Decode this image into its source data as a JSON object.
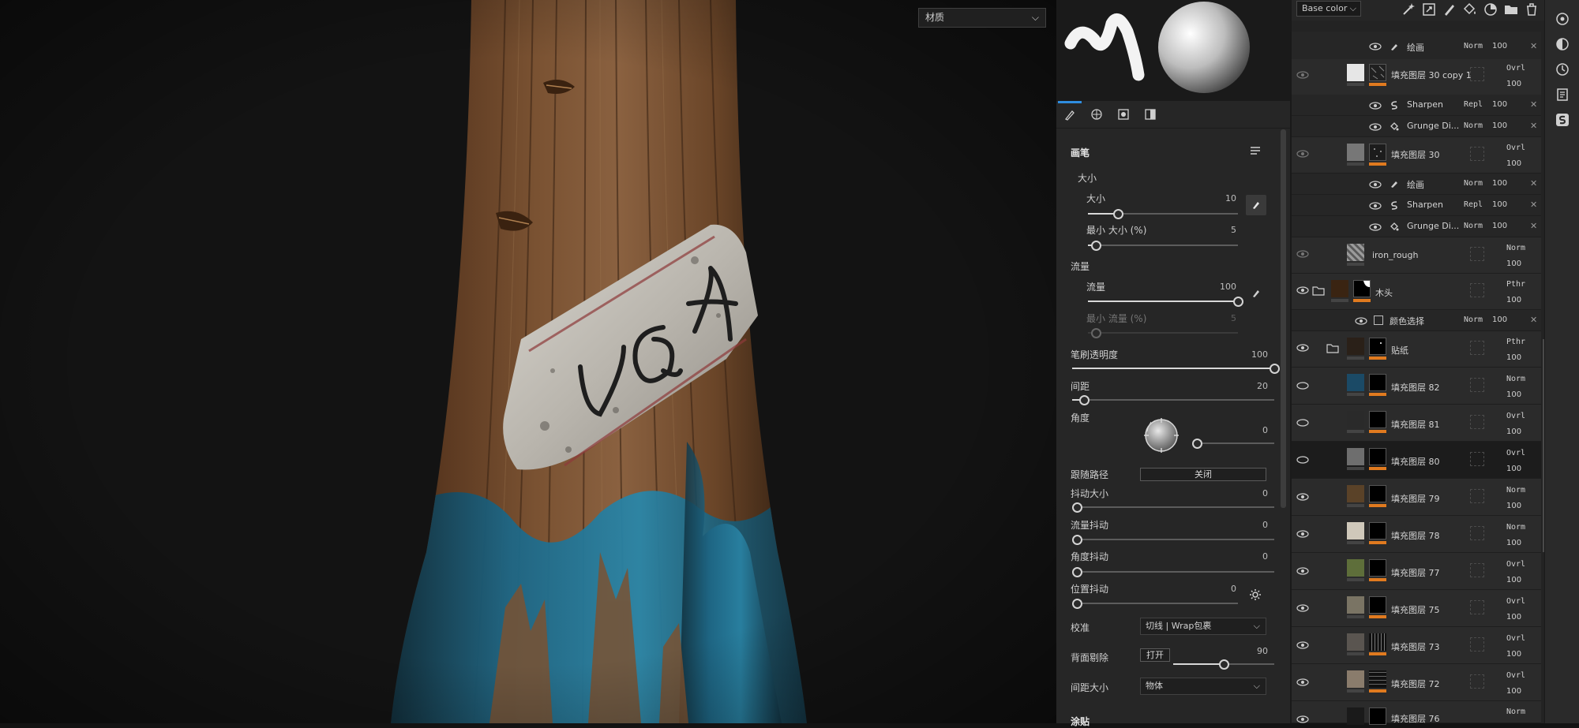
{
  "viewport": {
    "material_select": "材质"
  },
  "brush": {
    "section_title": "画笔",
    "size_group": "大小",
    "size_label": "大小",
    "size_value": "10",
    "size_fraction": 0.2,
    "min_size_label": "最小 大小 (%)",
    "min_size_value": "5",
    "min_size_fraction": 0.05,
    "flow_group": "流量",
    "flow_label": "流量",
    "flow_value": "100",
    "flow_fraction": 1.0,
    "min_flow_label": "最小 流量 (%)",
    "min_flow_value": "5",
    "min_flow_fraction": 0.05,
    "opacity_label": "笔刷透明度",
    "opacity_value": "100",
    "opacity_fraction": 1.0,
    "spacing_label": "间距",
    "spacing_value": "20",
    "spacing_fraction": 0.06,
    "angle_label": "角度",
    "angle_value": "0",
    "angle_fraction": 0.0,
    "follow_path_label": "跟随路径",
    "follow_path_button": "关闭",
    "size_jitter_label": "抖动大小",
    "size_jitter_value": "0",
    "flow_jitter_label": "流量抖动",
    "flow_jitter_value": "0",
    "angle_jitter_label": "角度抖动",
    "angle_jitter_value": "0",
    "position_jitter_label": "位置抖动",
    "position_jitter_value": "0",
    "alignment_label": "校准",
    "alignment_value": "切线 | Wrap包裹",
    "backface_label": "背面剔除",
    "backface_button": "打开",
    "backface_value": "90",
    "backface_fraction": 0.5,
    "spacing_size_label": "间距大小",
    "spacing_size_value": "物体",
    "stencil_label": "涂贴"
  },
  "layers": {
    "channel": "Base color",
    "items": [
      {
        "name": "绘画",
        "blend": "Norm",
        "opacity": "100"
      },
      {
        "name": "填充图层 30 copy 1",
        "blend": "Ovrl",
        "opacity": "100"
      },
      {
        "name": "Sharpen",
        "blend": "Repl",
        "opacity": "100"
      },
      {
        "name": "Grunge Di...",
        "blend": "Norm",
        "opacity": "100"
      },
      {
        "name": "填充图层 30",
        "blend": "Ovrl",
        "opacity": "100"
      },
      {
        "name": "绘画",
        "blend": "Norm",
        "opacity": "100"
      },
      {
        "name": "Sharpen",
        "blend": "Repl",
        "opacity": "100"
      },
      {
        "name": "Grunge Di...",
        "blend": "Norm",
        "opacity": "100"
      },
      {
        "name": "iron_rough",
        "blend": "Norm",
        "opacity": "100"
      },
      {
        "name": "木头",
        "blend": "Pthr",
        "opacity": "100"
      },
      {
        "name": "颜色选择",
        "blend": "Norm",
        "opacity": "100"
      },
      {
        "name": "贴纸",
        "blend": "Pthr",
        "opacity": "100"
      },
      {
        "name": "填充图层 82",
        "blend": "Norm",
        "opacity": "100"
      },
      {
        "name": "填充图层 81",
        "blend": "Ovrl",
        "opacity": "100"
      },
      {
        "name": "填充图层 80",
        "blend": "Ovrl",
        "opacity": "100"
      },
      {
        "name": "填充图层 79",
        "blend": "Norm",
        "opacity": "100"
      },
      {
        "name": "填充图层 78",
        "blend": "Norm",
        "opacity": "100"
      },
      {
        "name": "填充图层 77",
        "blend": "Ovrl",
        "opacity": "100"
      },
      {
        "name": "填充图层 75",
        "blend": "Ovrl",
        "opacity": "100"
      },
      {
        "name": "填充图层 73",
        "blend": "Ovrl",
        "opacity": "100"
      },
      {
        "name": "填充图层 72",
        "blend": "Ovrl",
        "opacity": "100"
      },
      {
        "name": "填充图层 76",
        "blend": "Norm",
        "opacity": ""
      }
    ],
    "colors": {
      "accent_orange": "#e07a1f",
      "selection_blue": "#2f8de0"
    }
  },
  "icons": {
    "toolbar": [
      "magic-wand-icon",
      "add-effect-icon",
      "paint-brush-icon",
      "fill-bucket-icon",
      "smart-material-icon",
      "folder-icon",
      "trash-icon"
    ],
    "rail": [
      "display-settings-icon",
      "shader-settings-icon",
      "history-icon",
      "log-icon",
      "substance-share-icon"
    ]
  }
}
